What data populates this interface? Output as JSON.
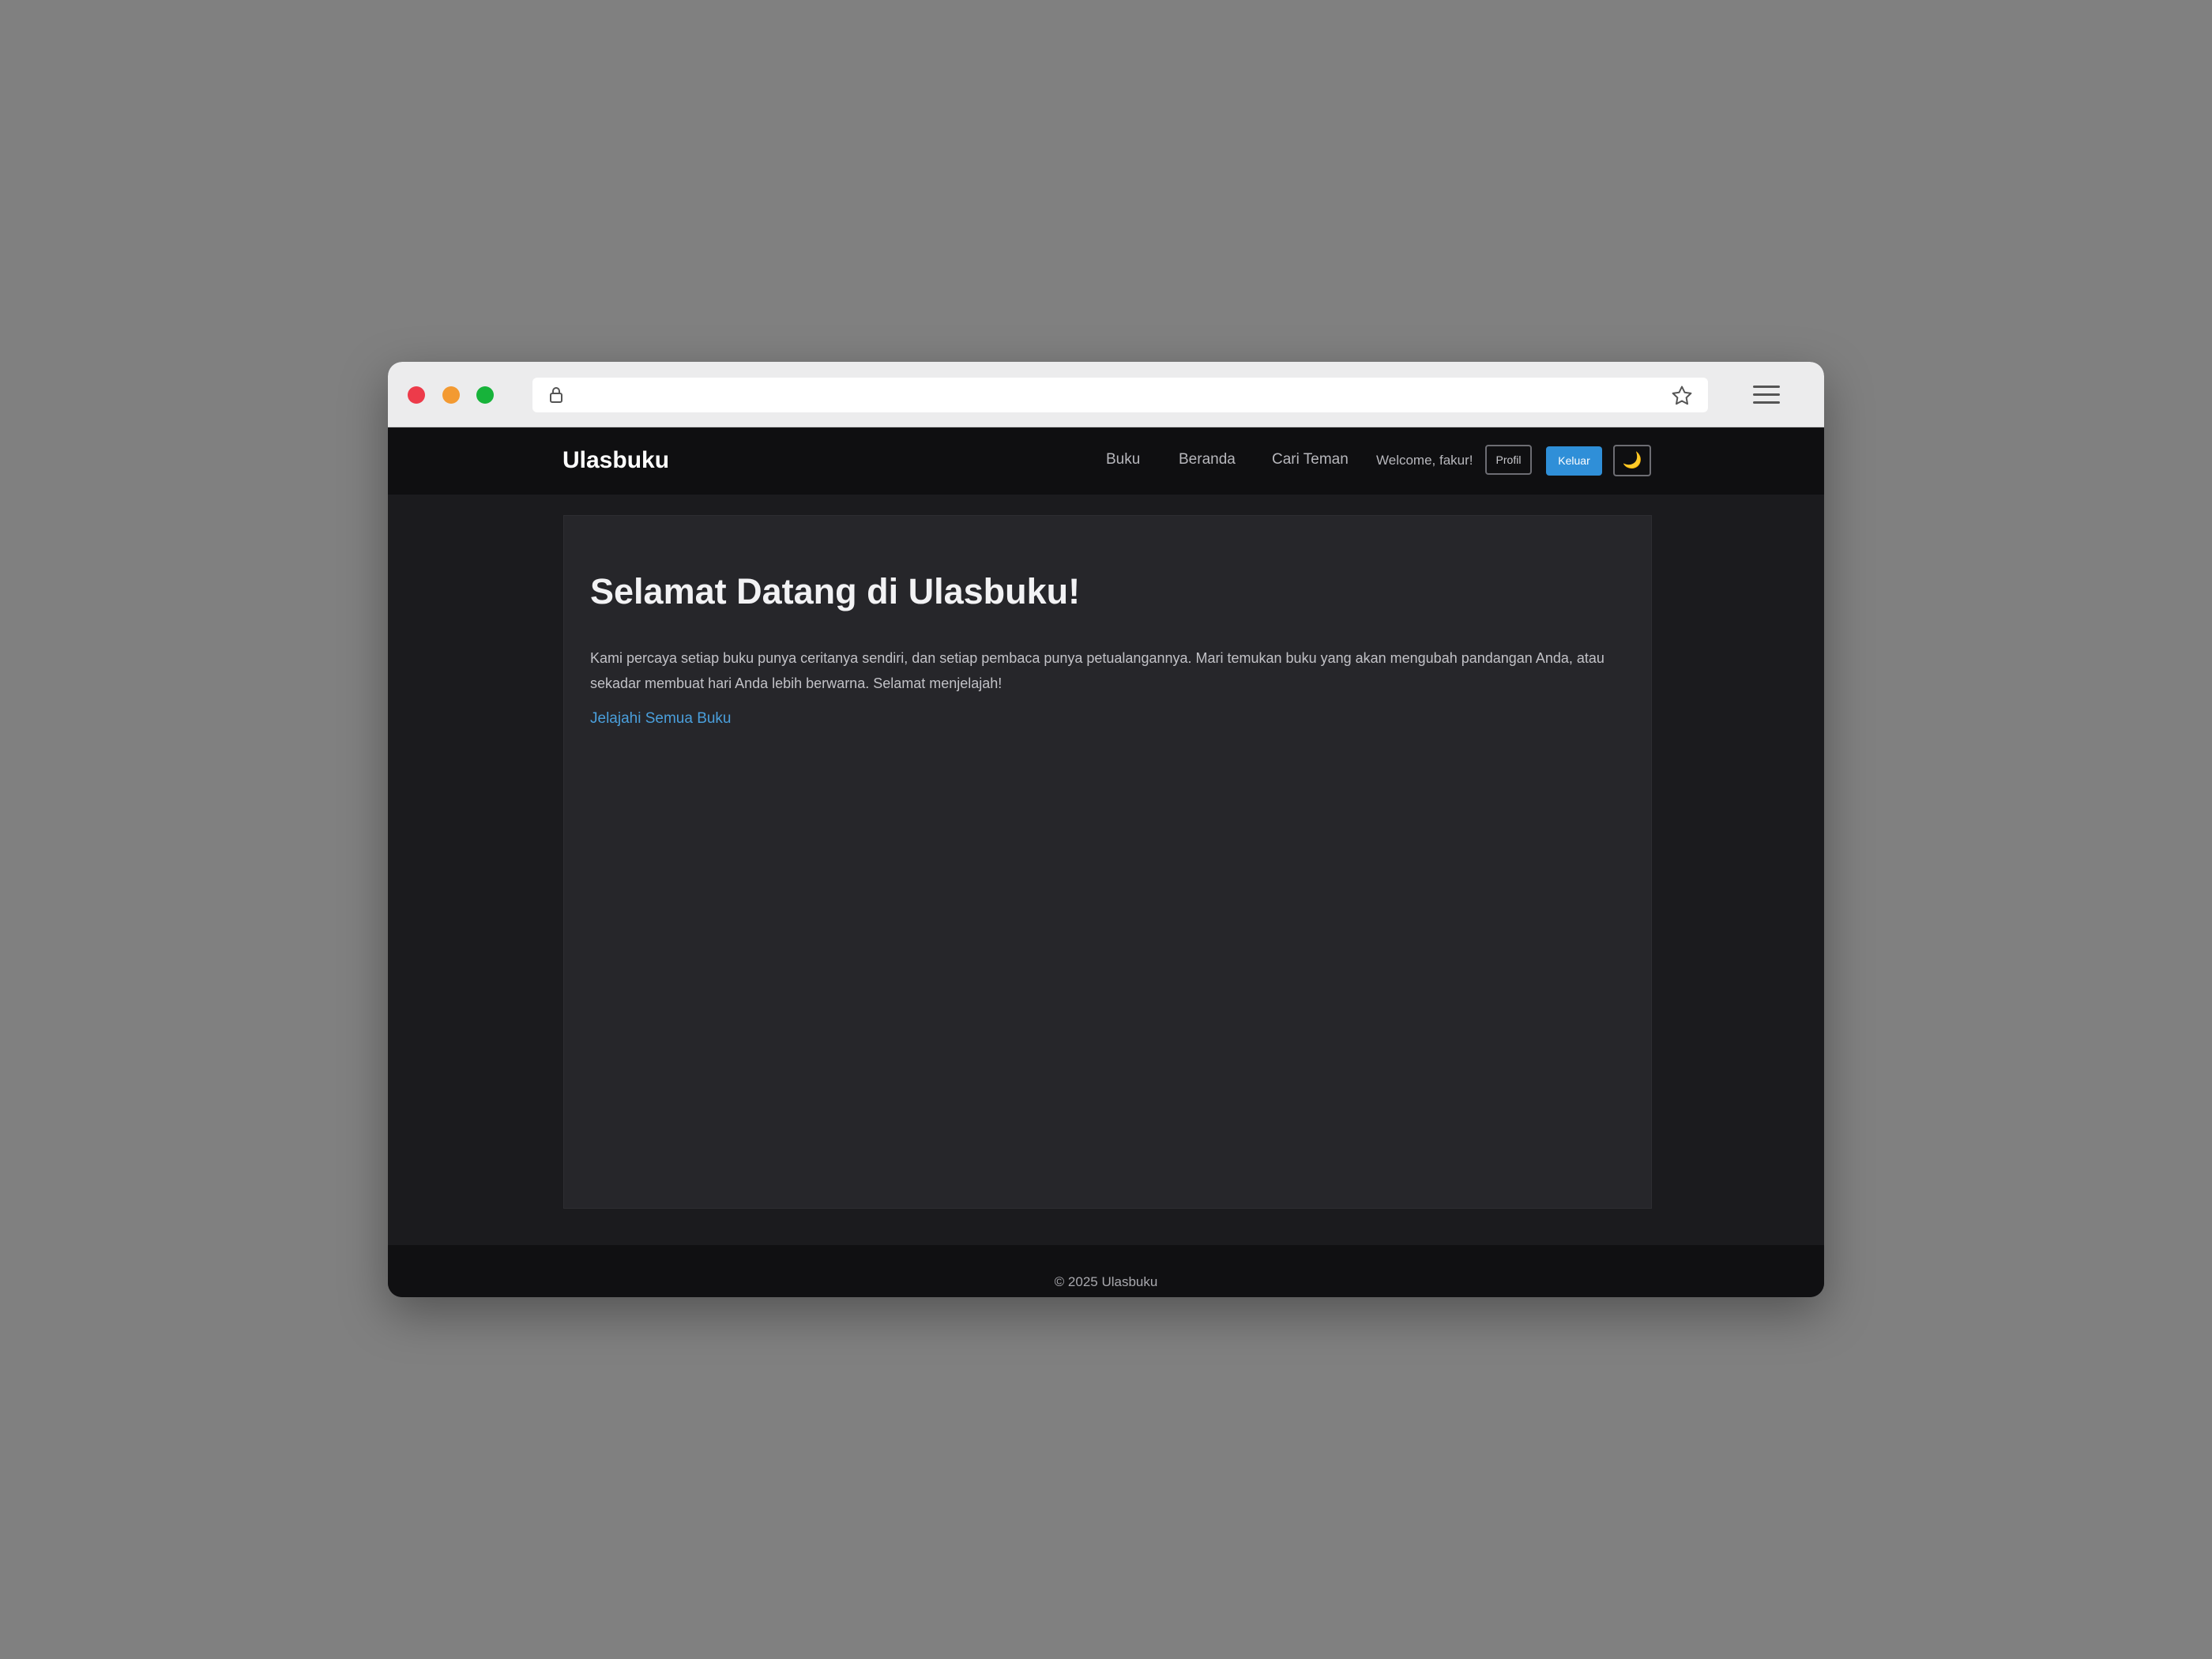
{
  "browser": {
    "icons": [
      "lock-icon",
      "star-icon",
      "menu-icon"
    ]
  },
  "navbar": {
    "brand": "Ulasbuku",
    "links": [
      "Buku",
      "Beranda",
      "Cari Teman"
    ],
    "welcome": "Welcome, fakur!",
    "profil_label": "Profil",
    "keluar_label": "Keluar",
    "theme_toggle_icon": "🌙"
  },
  "hero": {
    "title": "Selamat Datang di Ulasbuku!",
    "text": "Kami percaya setiap buku punya ceritanya sendiri, dan setiap pembaca punya petualangannya. Mari temukan buku yang akan mengubah pandangan Anda, atau sekadar membuat hari Anda lebih berwarna. Selamat menjelajah!",
    "link_label": "Jelajahi Semua Buku"
  },
  "footer": {
    "text": "© 2025 Ulasbuku"
  },
  "colors": {
    "accent": "#2f8fd8",
    "link": "#4a9fdc",
    "background": "#1b1b1e",
    "card": "#26262a",
    "navbar": "#0f0f11"
  }
}
